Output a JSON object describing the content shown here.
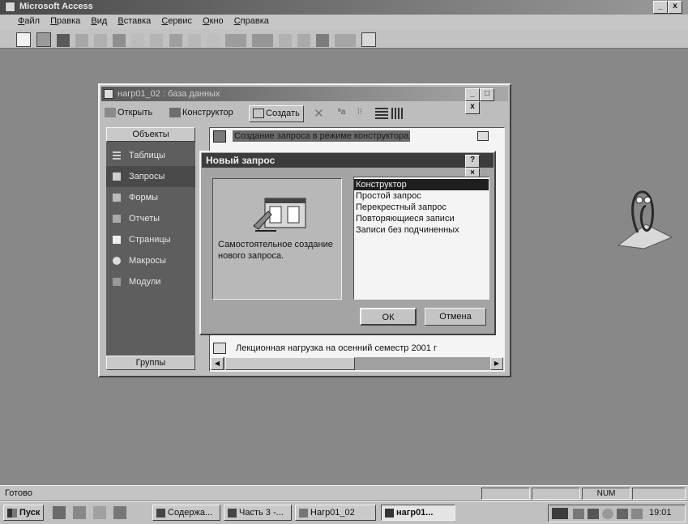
{
  "app": {
    "title": "Microsoft Access",
    "menu": [
      "Файл",
      "Правка",
      "Вид",
      "Вставка",
      "Сервис",
      "Окно",
      "Справка"
    ],
    "status_text": "Готово",
    "num_indicator": "NUM"
  },
  "db_window": {
    "title": "нагр01_02 : база данных",
    "toolbar": {
      "open": "Открыть",
      "design": "Конструктор",
      "create": "Создать"
    },
    "objects_header": "Объекты",
    "groups_label": "Группы",
    "objects": [
      "Таблицы",
      "Запросы",
      "Формы",
      "Отчеты",
      "Страницы",
      "Макросы",
      "Модули"
    ],
    "list_items": [
      "Создание запроса в режиме конструктора",
      "Лекционная нагрузка на осенний семестр 2001 г"
    ]
  },
  "dialog": {
    "title": "Новый запрос",
    "help": "?",
    "close": "×",
    "description": "Самостоятельное создание нового запроса.",
    "options": [
      "Конструктор",
      "Простой запрос",
      "Перекрестный запрос",
      "Повторяющиеся записи",
      "Записи без подчиненных"
    ],
    "selected_index": 0,
    "ok": "ОК",
    "cancel": "Отмена"
  },
  "taskbar": {
    "start": "Пуск",
    "tasks": [
      "Содержа...",
      "Часть 3 -...",
      "Нагр01_02",
      "нагр01..."
    ],
    "clock": "19:01"
  },
  "colors": {
    "desktop": "#8a8a8a",
    "title_bar": "#5c5c5c",
    "dialog_title": "#3a3a3a",
    "selection": "#1e1e1e"
  }
}
